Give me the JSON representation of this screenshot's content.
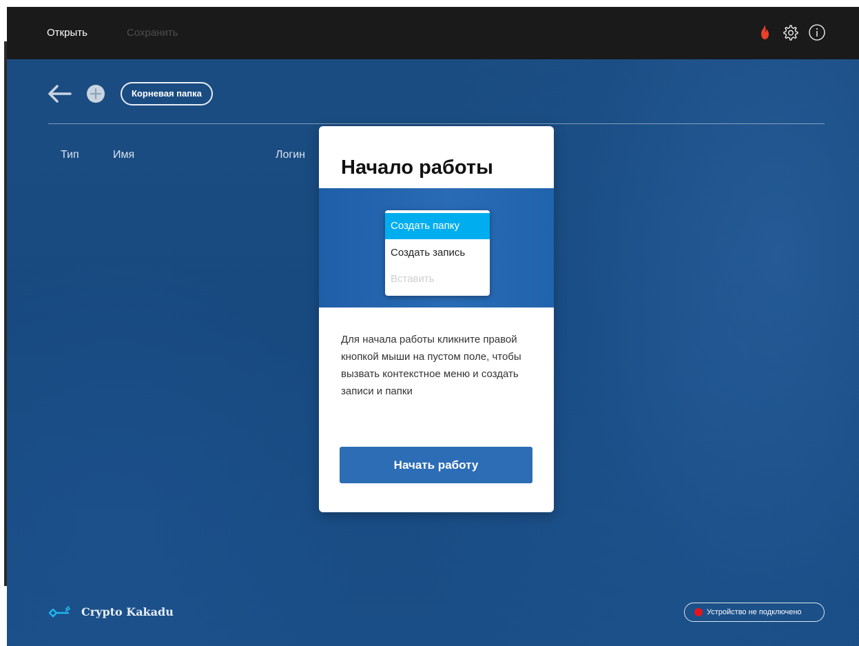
{
  "menu": {
    "open_label": "Открыть",
    "save_label": "Сохранить"
  },
  "toolbar": {
    "icons": {
      "fire": "fire-icon",
      "settings": "gear-icon",
      "info": "info-icon",
      "back": "back-arrow-icon",
      "add": "add-icon"
    },
    "root_folder_label": "Корневая папка"
  },
  "table": {
    "columns": [
      "Тип",
      "Имя",
      "Логин"
    ]
  },
  "modal": {
    "title": "Начало работы",
    "context_menu": {
      "items": [
        {
          "label": "Создать папку",
          "state": "highlighted"
        },
        {
          "label": "Создать запись",
          "state": "normal"
        },
        {
          "label": "Вставить",
          "state": "disabled"
        }
      ]
    },
    "description": "Для начала работы кликните правой кнопкой мыши на пустом поле, чтобы вызвать контекстное меню и создать записи и папки",
    "start_button_label": "Начать работу"
  },
  "footer": {
    "logo_text": "Crypto Kakadu",
    "status_text": "Устройство не подключено",
    "status_color": "#e3161e"
  },
  "colors": {
    "background": "#184a80",
    "topbar": "#1a1a1a",
    "accent": "#2c6db5",
    "menu_highlight": "#00aeef"
  }
}
